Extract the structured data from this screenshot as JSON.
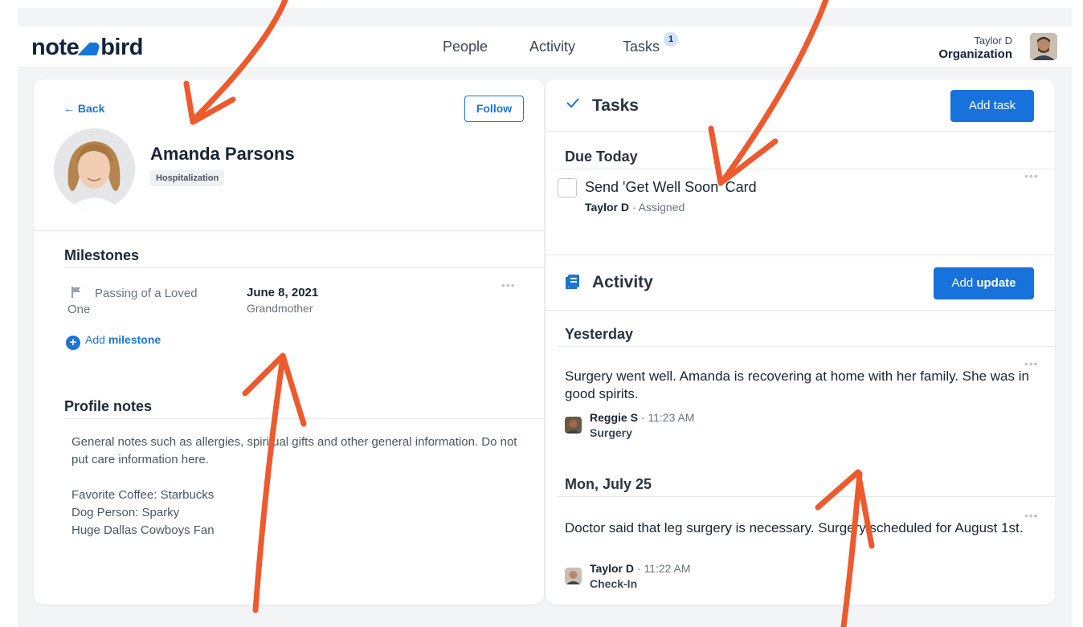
{
  "brand": {
    "name_left": "note",
    "name_right": "bird",
    "accent": "#1576d8"
  },
  "nav": {
    "items": [
      {
        "label": "People"
      },
      {
        "label": "Activity"
      },
      {
        "label": "Tasks"
      }
    ],
    "tasks_badge": "1"
  },
  "user": {
    "name": "Taylor D",
    "org": "Organization"
  },
  "profile": {
    "back_label": "Back",
    "follow_label": "Follow",
    "name": "Amanda Parsons",
    "tag": "Hospitalization"
  },
  "milestones": {
    "title": "Milestones",
    "items": [
      {
        "type": "Passing of a Loved One",
        "date": "June 8, 2021",
        "relation": "Grandmother"
      }
    ],
    "add_label_prefix": "Add",
    "add_label_bold": "milestone"
  },
  "notes": {
    "title": "Profile notes",
    "line1": "General notes such as allergies, spiritual gifts and other general information. Do not put care information here.",
    "line2": "Favorite Coffee: Starbucks",
    "line3": "Dog Person: Sparky",
    "line4": "Huge Dallas Cowboys Fan"
  },
  "tasks": {
    "title": "Tasks",
    "add_label": "Add task",
    "group": "Due Today",
    "items": [
      {
        "title": "Send 'Get Well Soon' Card",
        "assignee": "Taylor D",
        "status": "Assigned"
      }
    ]
  },
  "activity": {
    "title": "Activity",
    "add_label_prefix": "Add",
    "add_label_bold": "update",
    "groups": [
      {
        "label": "Yesterday",
        "entry": {
          "text": "Surgery went well. Amanda is recovering at home with her family. She was in good spirits.",
          "author": "Reggie S",
          "time": "11:23 AM",
          "type": "Surgery"
        }
      },
      {
        "label": "Mon, July 25",
        "entry": {
          "text": "Doctor said that leg surgery is necessary. Surgery scheduled for August 1st.",
          "author": "Taylor D",
          "time": "11:22 AM",
          "type": "Check-In"
        }
      }
    ]
  },
  "annotation_color": "#ec5a2e"
}
